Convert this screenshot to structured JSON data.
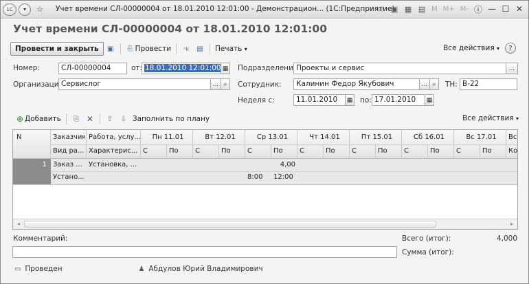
{
  "window": {
    "title": "Учет времени СЛ-00000004 от 18.01.2010 12:01:00 - Демонстрацион... (1С:Предприятие)",
    "app_logo": "1С",
    "controls": {
      "m": "M",
      "m_plus": "M+",
      "m_minus": "M-"
    }
  },
  "form": {
    "title": "Учет времени СЛ-00000004 от 18.01.2010 12:01:00"
  },
  "toolbar": {
    "post_and_close": "Провести и закрыть",
    "post": "Провести",
    "print": "Печать",
    "all_actions": "Все действия",
    "help": "?"
  },
  "fields": {
    "number_label": "Номер:",
    "number_value": "СЛ-00000004",
    "from_label": "от:",
    "from_value": "18.01.2010 12:01:00",
    "division_label": "Подразделение:",
    "division_value": "Проекты и сервис",
    "org_label": "Организация:",
    "org_value": "Сервислог",
    "employee_label": "Сотрудник:",
    "employee_value": "Калинин Федор Якубович",
    "tn_label": "ТН:",
    "tn_value": "В-22",
    "week_label": "Неделя с:",
    "week_from": "11.01.2010",
    "week_to_label": "по:",
    "week_to": "17.01.2010"
  },
  "table_toolbar": {
    "add": "Добавить",
    "fill": "Заполнить по плану",
    "all_actions": "Все действия"
  },
  "table": {
    "header_top": [
      "N",
      "Заказчик",
      "Работа, услу...",
      "Пн 11.01",
      "Вт 12.01",
      "Ср 13.01",
      "Чт 14.01",
      "Пт 15.01",
      "Сб 16.01",
      "Вс 17.01",
      "Все"
    ],
    "header_bottom": [
      "",
      "Вид ра...",
      "Характерис...",
      "С",
      "По",
      "С",
      "По",
      "С",
      "По",
      "С",
      "По",
      "С",
      "По",
      "С",
      "По",
      "С",
      "По",
      "Ком"
    ],
    "row1": {
      "n": "1",
      "customer": "Заказ ...",
      "work": "Установка, ...",
      "wed_total": "4,00",
      "kind": "Устано...",
      "wed_from": "8:00",
      "wed_to": "12:00"
    }
  },
  "footer": {
    "comment_label": "Комментарий:",
    "total_label": "Всего (итог):",
    "total_value": "4,000",
    "sum_label": "Сумма (итог):",
    "status": "Проведен",
    "author": "Абдулов Юрий Владимирович"
  }
}
